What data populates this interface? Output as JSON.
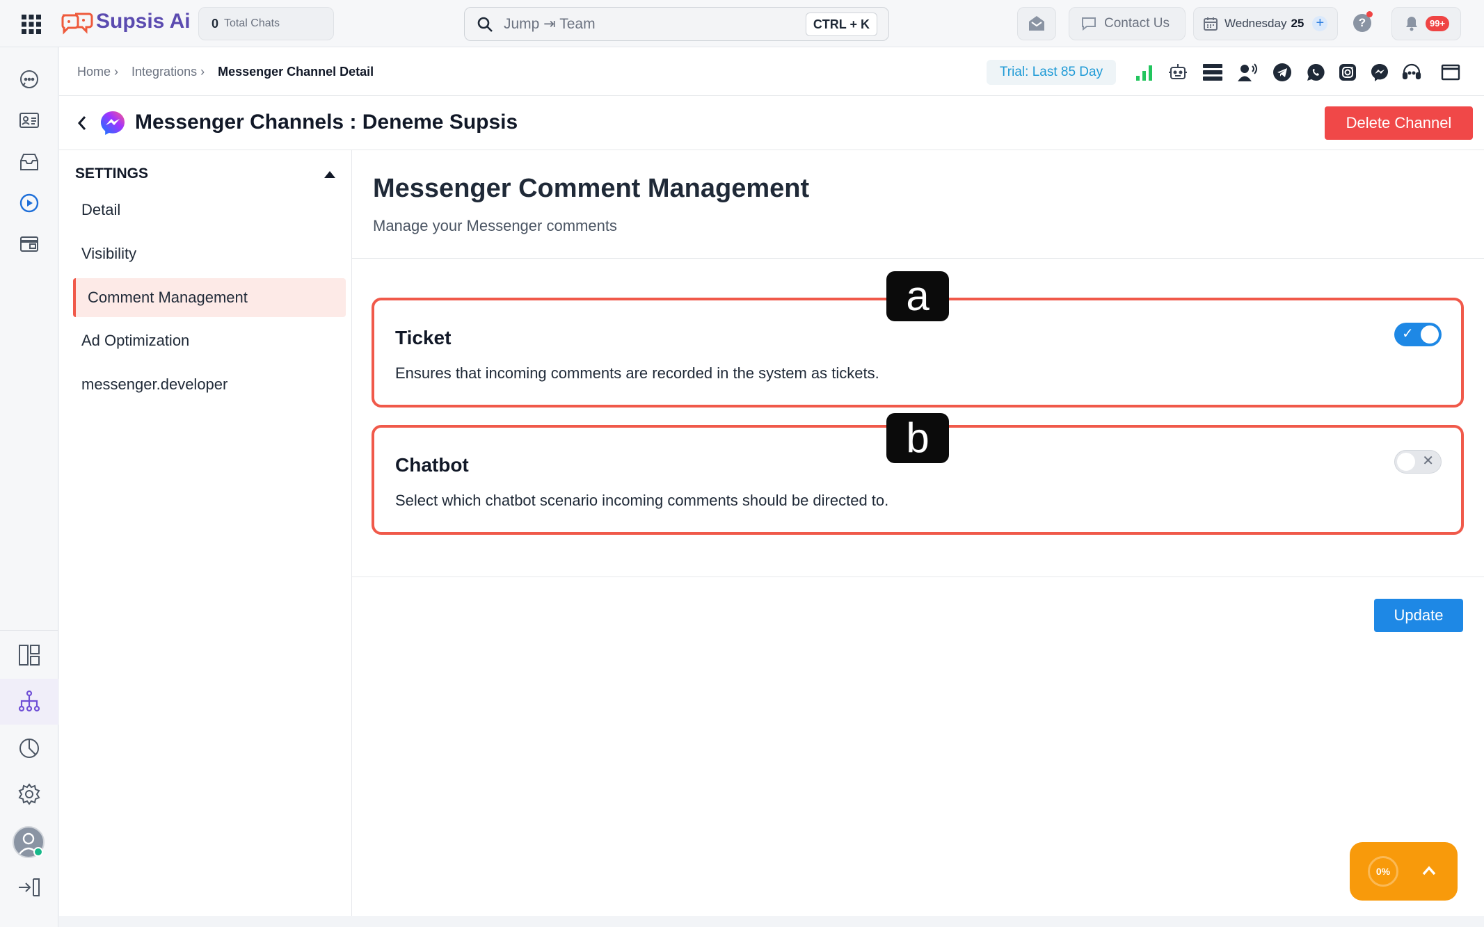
{
  "brand": {
    "name": "Supsis Ai"
  },
  "topbar": {
    "total_chats_count": "0",
    "total_chats_label": "Total Chats",
    "search_placeholder": "Jump ⇥ Team",
    "search_shortcut": "CTRL + K",
    "contact_us": "Contact Us",
    "date_weekday": "Wednesday",
    "date_day": "25",
    "notifications_badge": "99+"
  },
  "breadcrumb": {
    "home": "Home ›",
    "integrations": "Integrations ›",
    "current": "Messenger Channel Detail"
  },
  "trial_label": "Trial: Last 85 Day",
  "page": {
    "title": "Messenger Channels : Deneme Supsis",
    "delete_button": "Delete Channel"
  },
  "settings_nav": {
    "header": "SETTINGS",
    "items": [
      {
        "label": "Detail"
      },
      {
        "label": "Visibility"
      },
      {
        "label": "Comment Management",
        "active": true
      },
      {
        "label": "Ad Optimization"
      },
      {
        "label": "messenger.developer"
      }
    ]
  },
  "section": {
    "title": "Messenger Comment Management",
    "subtitle": "Manage your Messenger comments"
  },
  "cards": [
    {
      "badge": "a",
      "title": "Ticket",
      "description": "Ensures that incoming comments are recorded in the system as tickets.",
      "enabled": true
    },
    {
      "badge": "b",
      "title": "Chatbot",
      "description": "Select which chatbot scenario incoming comments should be directed to.",
      "enabled": false
    }
  ],
  "update_button": "Update",
  "progress_widget": {
    "percent_label": "0%"
  },
  "colors": {
    "accent_blue": "#1e88e5",
    "danger": "#f04848",
    "highlight_border": "#f0594a",
    "progress_orange": "#f89a0b"
  }
}
